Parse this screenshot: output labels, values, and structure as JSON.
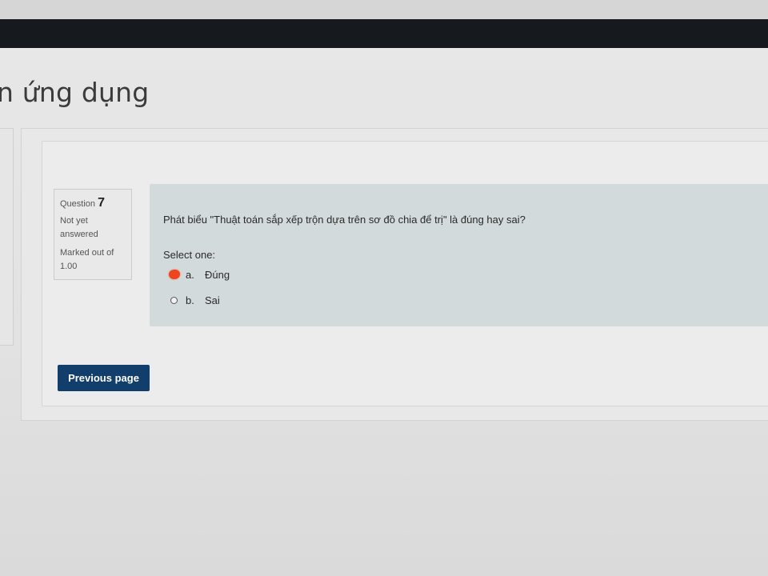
{
  "page": {
    "title": "n ứng dụng"
  },
  "question": {
    "label": "Question",
    "number": "7",
    "state": "Not yet answered",
    "grade": "Marked out of 1.00",
    "text": "Phát biểu \"Thuật toán sắp xếp trộn dựa trên sơ đồ chia để trị\" là đúng hay sai?",
    "prompt": "Select one:",
    "answers": [
      {
        "num": "a.",
        "label": "Đúng"
      },
      {
        "num": "b.",
        "label": "Sai"
      }
    ]
  },
  "navigation": {
    "previous_label": "Previous page"
  },
  "colors": {
    "navbar": "#16191d",
    "button": "#113e6b",
    "question_body": "#d3dadb",
    "marker": "#f0441c"
  }
}
